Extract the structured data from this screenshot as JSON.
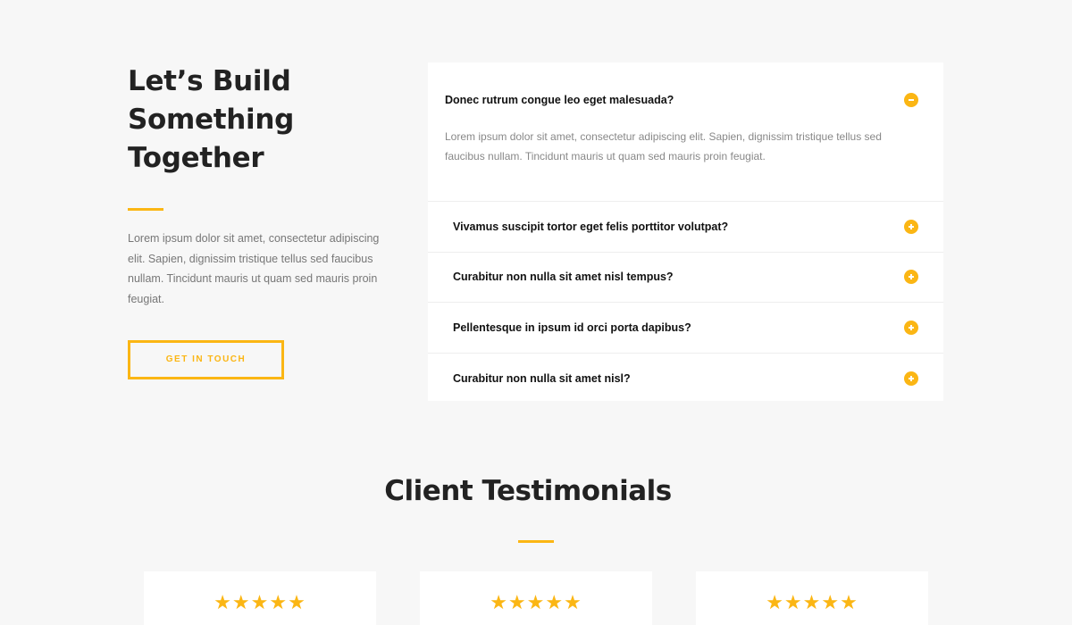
{
  "hero": {
    "headline": [
      "Let’s Build",
      "Something",
      "Together"
    ],
    "intro": "Lorem ipsum dolor sit amet, consectetur adipiscing elit. Sapien, dignissim tristique tellus sed faucibus nullam. Tincidunt mauris ut quam sed mauris proin feugiat.",
    "cta_label": "GET IN TOUCH"
  },
  "faq": {
    "open": {
      "question": "Donec rutrum congue leo eget malesuada?",
      "answer": "Lorem ipsum dolor sit amet, consectetur adipiscing elit. Sapien, dignissim tristique tellus sed faucibus nullam. Tincidunt mauris ut quam sed mauris proin feugiat."
    },
    "items": [
      "Vivamus suscipit tortor eget felis porttitor volutpat?",
      "Curabitur non nulla sit amet nisl tempus?",
      "Pellentesque in ipsum id orci porta dapibus?",
      "Curabitur non nulla sit amet nisl?"
    ]
  },
  "testimonials": {
    "title": "Client Testimonials",
    "cards": [
      {
        "stars": "★★★★★",
        "rating": 5
      },
      {
        "stars": "★★★★★",
        "rating": 5
      },
      {
        "stars": "★★★★★",
        "rating": 5
      }
    ]
  },
  "colors": {
    "accent": "#fbb614",
    "background": "#f7f7f7",
    "card": "#ffffff"
  },
  "icons": {
    "toggle_open": "minus-circle-icon",
    "toggle_closed": "plus-circle-icon",
    "star": "star-icon"
  }
}
